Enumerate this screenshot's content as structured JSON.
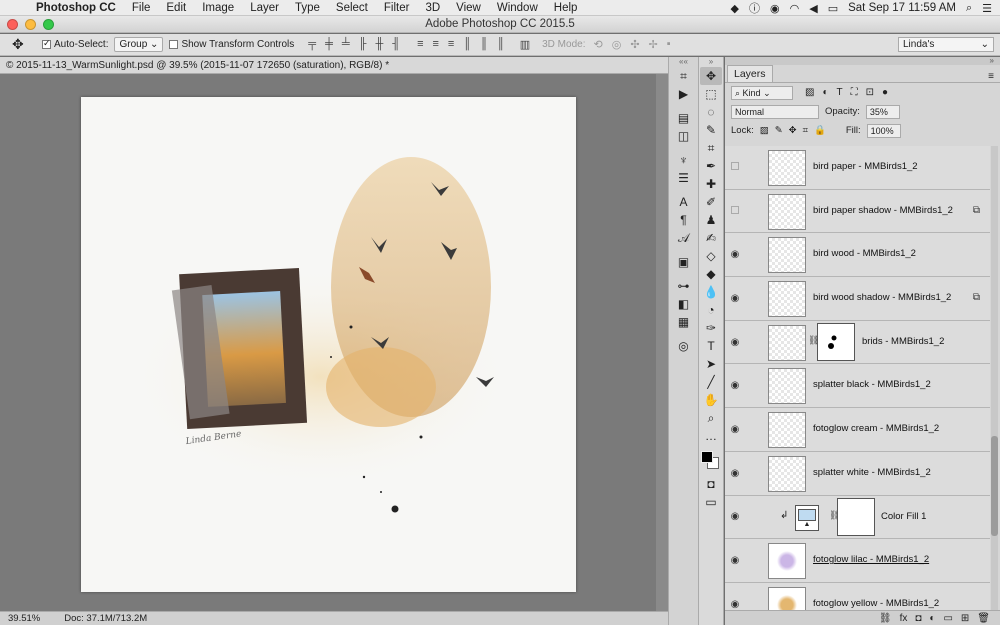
{
  "menubar": {
    "app": "Photoshop CC",
    "items": [
      "File",
      "Edit",
      "Image",
      "Layer",
      "Type",
      "Select",
      "Filter",
      "3D",
      "View",
      "Window",
      "Help"
    ],
    "clock": "Sat Sep 17  11:59 AM"
  },
  "window": {
    "title": "Adobe Photoshop CC 2015.5"
  },
  "options": {
    "auto_select_label": "Auto-Select:",
    "auto_select_value": "Group",
    "transform_label": "Show Transform Controls",
    "mode_label": "3D Mode:",
    "workspace": "Linda's"
  },
  "document": {
    "tab": "© 2015-11-13_WarmSunlight.psd @ 39.5% (2015-11-07 172650 (saturation), RGB/8) *",
    "zoom": "39.51%",
    "doc_size": "Doc: 37.1M/713.2M"
  },
  "layers_panel": {
    "tab": "Layers",
    "kind": "Kind",
    "blend_mode": "Normal",
    "opacity_label": "Opacity:",
    "opacity": "35%",
    "lock_label": "Lock:",
    "fill_label": "Fill:",
    "fill": "100%",
    "layers": [
      {
        "name": "bird paper - MMBirds1_2",
        "visible": false,
        "fx": false
      },
      {
        "name": "bird paper shadow - MMBirds1_2",
        "visible": false,
        "fx": true
      },
      {
        "name": "bird wood - MMBirds1_2",
        "visible": true,
        "fx": false
      },
      {
        "name": "bird wood shadow - MMBirds1_2",
        "visible": true,
        "fx": true
      },
      {
        "name": "brids - MMBirds1_2",
        "visible": true,
        "fx": false,
        "mask": true
      },
      {
        "name": "splatter black - MMBirds1_2",
        "visible": true,
        "fx": false
      },
      {
        "name": "fotoglow cream - MMBirds1_2",
        "visible": true,
        "fx": false
      },
      {
        "name": "splatter white - MMBirds1_2",
        "visible": true,
        "fx": false
      },
      {
        "name": "Color Fill 1",
        "visible": true,
        "fx": false,
        "fill": true
      },
      {
        "name": "fotoglow lilac - MMBirds1_2",
        "visible": true,
        "fx": false
      },
      {
        "name": "fotoglow yellow - MMBirds1_2",
        "visible": true,
        "fx": false
      }
    ]
  },
  "canvas": {
    "signature": "Linda Berne"
  },
  "colors": {
    "fill_swatch": "#bfdbf1",
    "foreground": "#000000",
    "background": "#ffffff"
  }
}
